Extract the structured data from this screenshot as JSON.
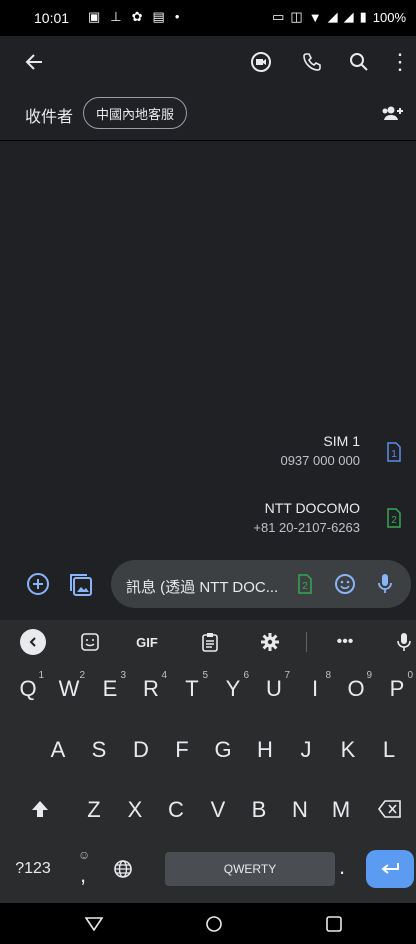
{
  "status": {
    "time": "10:01",
    "battery": "100%"
  },
  "recipients": {
    "label": "收件者",
    "chip": "中國內地客服"
  },
  "sims": [
    {
      "name": "SIM 1",
      "number": "0937 000 000",
      "badge": "1"
    },
    {
      "name": "NTT DOCOMO",
      "number": "+81 20-2107-6263",
      "badge": "2"
    }
  ],
  "composer": {
    "placeholder": "訊息 (透過 NTT DOC...",
    "sim_badge": "2"
  },
  "keyboard": {
    "toolbar": {
      "gif": "GIF"
    },
    "row1": [
      {
        "k": "Q",
        "h": "1"
      },
      {
        "k": "W",
        "h": "2"
      },
      {
        "k": "E",
        "h": "3"
      },
      {
        "k": "R",
        "h": "4"
      },
      {
        "k": "T",
        "h": "5"
      },
      {
        "k": "Y",
        "h": "6"
      },
      {
        "k": "U",
        "h": "7"
      },
      {
        "k": "I",
        "h": "8"
      },
      {
        "k": "O",
        "h": "9"
      },
      {
        "k": "P",
        "h": "0"
      }
    ],
    "row2": [
      "A",
      "S",
      "D",
      "F",
      "G",
      "H",
      "J",
      "K",
      "L"
    ],
    "row3": [
      "Z",
      "X",
      "C",
      "V",
      "B",
      "N",
      "M"
    ],
    "num_key": "?123",
    "comma": ",",
    "space": "QWERTY",
    "period": "."
  }
}
